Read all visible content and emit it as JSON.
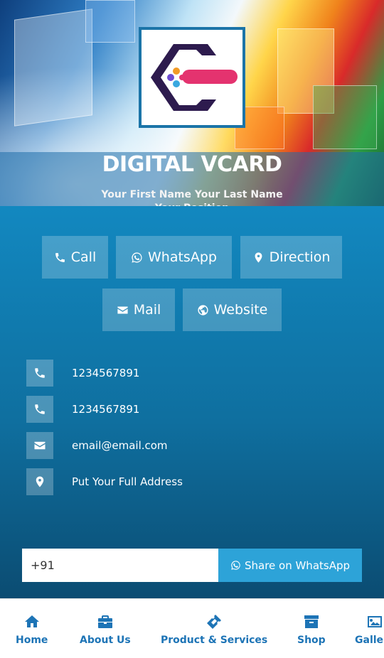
{
  "header": {
    "brand_title": "DIGITAL VCARD",
    "person_name": "Your First Name Your Last Name",
    "person_position": "Your Position"
  },
  "actions": [
    {
      "label": "Call",
      "icon": "phone-icon"
    },
    {
      "label": "WhatsApp",
      "icon": "whatsapp-icon"
    },
    {
      "label": "Direction",
      "icon": "map-marker-icon"
    },
    {
      "label": "Mail",
      "icon": "envelope-icon"
    },
    {
      "label": "Website",
      "icon": "globe-icon"
    }
  ],
  "contacts": [
    {
      "icon": "phone-icon",
      "text": "1234567891"
    },
    {
      "icon": "phone-icon",
      "text": "1234567891"
    },
    {
      "icon": "envelope-icon",
      "text": "email@email.com"
    },
    {
      "icon": "map-marker-icon",
      "text": "Put Your Full Address"
    }
  ],
  "share": {
    "phone_value": "+91",
    "button_label": "Share on WhatsApp"
  },
  "nav": [
    {
      "label": "Home",
      "icon": "home-icon"
    },
    {
      "label": "About Us",
      "icon": "briefcase-icon"
    },
    {
      "label": "Product & Services",
      "icon": "ticket-icon"
    },
    {
      "label": "Shop",
      "icon": "archive-icon"
    },
    {
      "label": "Gallery",
      "icon": "image-icon"
    }
  ],
  "colors": {
    "primary": "#1288c0",
    "nav_text": "#1d74b6",
    "share_button": "#2da3d8"
  }
}
